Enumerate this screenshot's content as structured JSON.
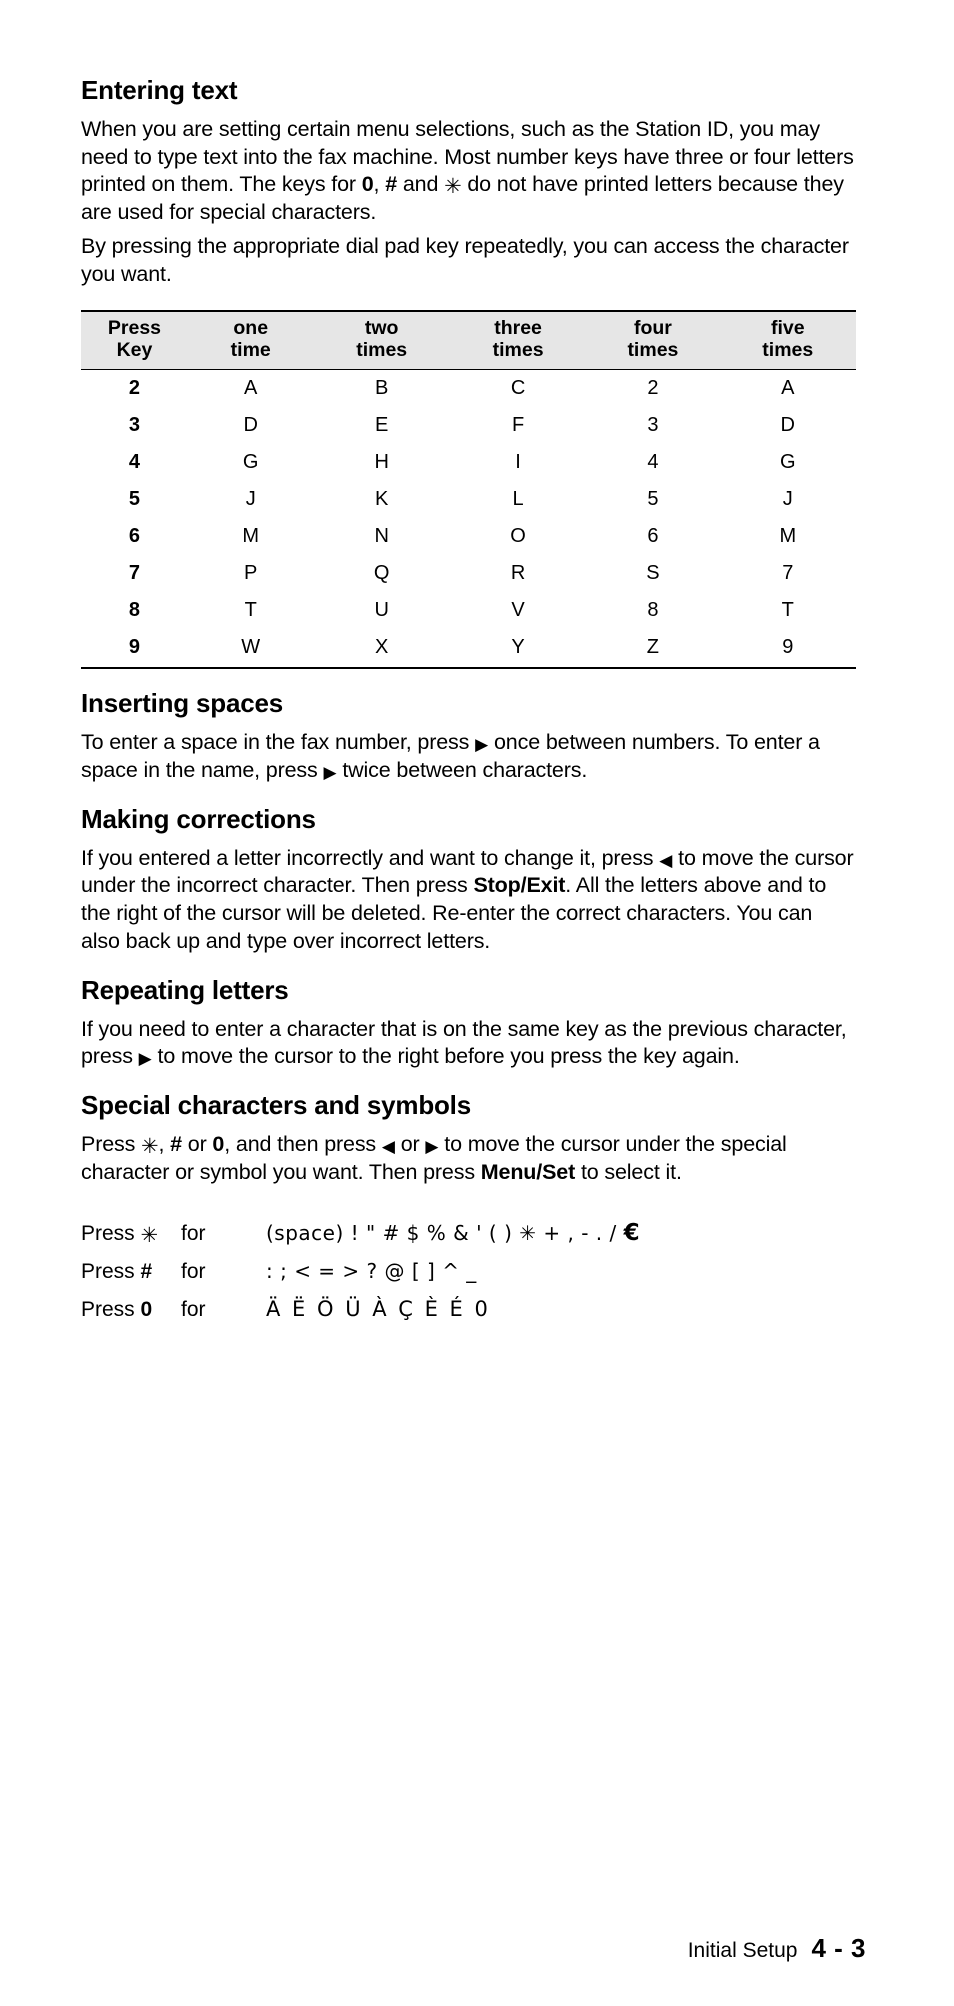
{
  "page": {
    "heading": "Entering text",
    "intro_paragraph_1_part1": "When you are setting certain menu selections, such as the Station ID, you may need to type text into the fax machine. Most number keys have three or four letters printed on them. The keys for ",
    "intro_key_0": "0",
    "intro_comma": ", ",
    "intro_key_hash": "#",
    "intro_and": " and ",
    "intro_key_star": "✳",
    "intro_paragraph_1_part2": " do not have printed letters because they are used for special characters.",
    "intro_paragraph_2": "By pressing the appropriate dial pad key repeatedly, you can access the character you want."
  },
  "key_table": {
    "headers": [
      {
        "line1": "Press",
        "line2": "Key"
      },
      {
        "line1": "one",
        "line2": "time"
      },
      {
        "line1": "two",
        "line2": "times"
      },
      {
        "line1": "three",
        "line2": "times"
      },
      {
        "line1": "four",
        "line2": "times"
      },
      {
        "line1": "five",
        "line2": "times"
      }
    ],
    "rows": [
      [
        "2",
        "A",
        "B",
        "C",
        "2",
        "A"
      ],
      [
        "3",
        "D",
        "E",
        "F",
        "3",
        "D"
      ],
      [
        "4",
        "G",
        "H",
        "I",
        "4",
        "G"
      ],
      [
        "5",
        "J",
        "K",
        "L",
        "5",
        "J"
      ],
      [
        "6",
        "M",
        "N",
        "O",
        "6",
        "M"
      ],
      [
        "7",
        "P",
        "Q",
        "R",
        "S",
        "7"
      ],
      [
        "8",
        "T",
        "U",
        "V",
        "8",
        "T"
      ],
      [
        "9",
        "W",
        "X",
        "Y",
        "Z",
        "9"
      ]
    ]
  },
  "inserting_spaces": {
    "title": "Inserting spaces",
    "text_a": "To enter a space in the fax number, press ",
    "text_b": " once between numbers. To enter a space in the name, press ",
    "text_c": " twice between characters.",
    "arrow_right": "▶"
  },
  "making_corrections": {
    "title": "Making corrections",
    "text_a": "If you entered a letter incorrectly and want to change it, press ",
    "arrow_left": "◀",
    "text_b": " to move the cursor under the incorrect character. Then press ",
    "bold_key": "Stop/Exit",
    "text_c": ". All the letters above and to the right of the cursor will be deleted. Re-enter the correct characters. You can also back up and type over incorrect letters."
  },
  "repeating_letters": {
    "title": "Repeating letters",
    "text_a": "If you need to enter a character that is on the same key as the previous character, press ",
    "arrow_right": "▶",
    "text_b": " to move the cursor to the right before you press the key again."
  },
  "special_characters": {
    "title": "Special characters and symbols",
    "text_a": "Press ",
    "star": "✳",
    "text_b": ", ",
    "hash": "#",
    "text_c": " or ",
    "zero": "0",
    "text_d": ", and then press ",
    "arrow_left": "◀",
    "text_e": " or ",
    "arrow_right": "▶",
    "text_f": " to move the cursor under the special character or symbol you want. Then press ",
    "bold_key": "Menu/Set",
    "text_g": " to select it."
  },
  "char_list": {
    "for_label": "for",
    "rows": [
      {
        "press_word": "Press",
        "key": "✳",
        "chars": "(space) ! \" # $ % & ' ( ) ✳ + , - . /",
        "trailing_symbol": "€"
      },
      {
        "press_word": "Press",
        "key": "#",
        "chars": ": ; < = > ? @ [ ] ^ _",
        "trailing_symbol": ""
      },
      {
        "press_word": "Press",
        "key": "0",
        "chars": "Ä Ë Ö Ü À Ç È É 0",
        "trailing_symbol": ""
      }
    ]
  },
  "footer": {
    "chapter_label": "Initial Setup",
    "page_number": "4 - 3"
  },
  "colors": {
    "text": "#000000",
    "table_header_bg": "#e6e6e6",
    "rule": "#000000",
    "page_bg": "#ffffff"
  }
}
